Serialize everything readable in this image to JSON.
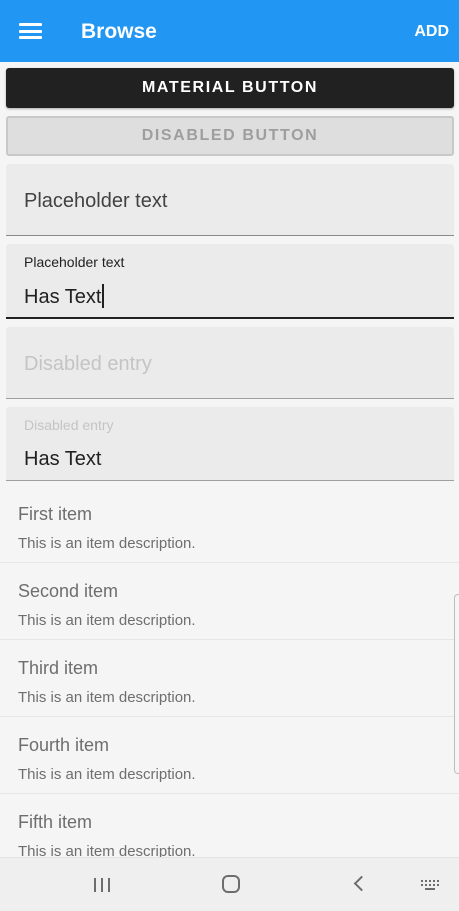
{
  "app_bar": {
    "title": "Browse",
    "action_label": "ADD",
    "color": "#2196f3"
  },
  "buttons": {
    "material_label": "MATERIAL BUTTON",
    "disabled_label": "DISABLED BUTTON"
  },
  "entries": [
    {
      "placeholder": "Placeholder text",
      "value": "",
      "state": "empty"
    },
    {
      "placeholder": "Placeholder text",
      "value": "Has Text",
      "state": "focused"
    },
    {
      "placeholder": "Disabled entry",
      "value": "",
      "state": "disabled"
    },
    {
      "placeholder": "Disabled entry",
      "value": "Has Text",
      "state": "disabled"
    }
  ],
  "list_items": [
    {
      "title": "First item",
      "description": "This is an item description."
    },
    {
      "title": "Second item",
      "description": "This is an item description."
    },
    {
      "title": "Third item",
      "description": "This is an item description."
    },
    {
      "title": "Fourth item",
      "description": "This is an item description."
    },
    {
      "title": "Fifth item",
      "description": "This is an item description."
    }
  ],
  "nav_bar": {
    "icons": [
      "recents-icon",
      "home-icon",
      "back-icon",
      "keyboard-icon"
    ]
  }
}
